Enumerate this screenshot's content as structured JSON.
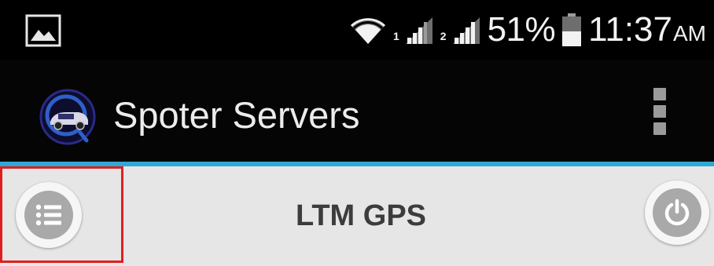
{
  "status_bar": {
    "battery_percent": "51%",
    "battery_level": 0.51,
    "time": "11:37",
    "ampm": "AM",
    "sim1_label": "1",
    "sim2_label": "2",
    "icons": [
      "gallery-notification-icon",
      "wifi-icon",
      "signal-sim1-icon",
      "signal-sim2-icon",
      "battery-icon"
    ]
  },
  "action_bar": {
    "app_title": "Spoter Servers",
    "logo_icon": "app-logo-icon",
    "overflow_icon": "overflow-menu-icon"
  },
  "sub_header": {
    "title": "LTM GPS",
    "menu_icon": "list-icon",
    "power_icon": "power-icon"
  },
  "colors": {
    "status_bar_bg": "#000000",
    "action_bar_bg": "#050505",
    "accent": "#2fa8d6",
    "subheader_bg": "#e6e6e6",
    "button_gray": "#a9a9a9",
    "highlight": "#e01e1e"
  }
}
